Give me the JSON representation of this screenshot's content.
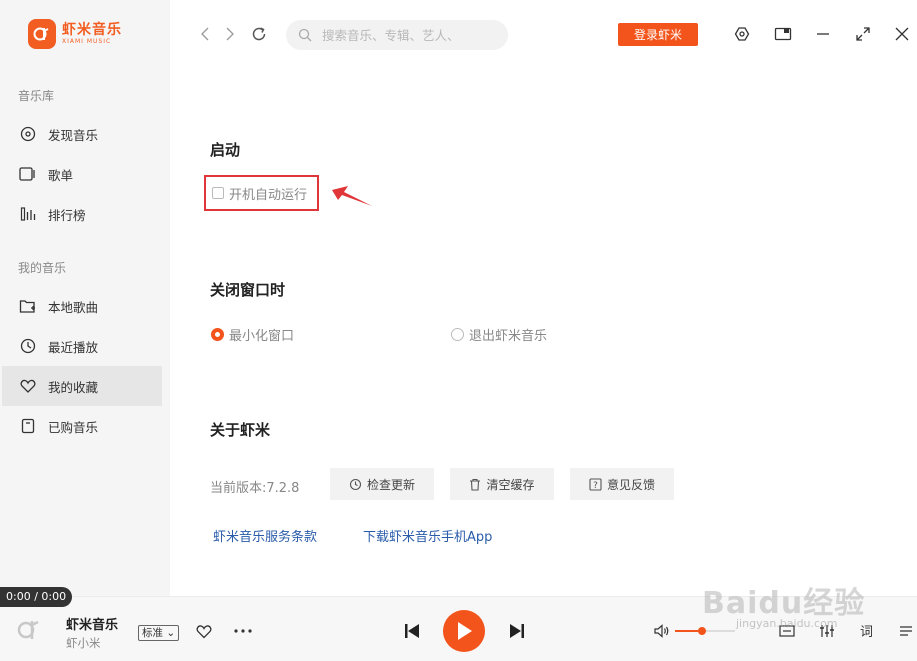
{
  "app": {
    "logo_cn": "虾米音乐",
    "logo_en": "XIAMI MUSIC",
    "brand_color": "#f2541b"
  },
  "header": {
    "search_placeholder": "搜索音乐、专辑、艺人、",
    "login_label": "登录虾米"
  },
  "sidebar": {
    "library_title": "音乐库",
    "library_items": [
      {
        "label": "发现音乐",
        "icon": "disc-icon"
      },
      {
        "label": "歌单",
        "icon": "playlist-icon"
      },
      {
        "label": "排行榜",
        "icon": "chart-bars-icon"
      }
    ],
    "mine_title": "我的音乐",
    "mine_items": [
      {
        "label": "本地歌曲",
        "icon": "folder-icon"
      },
      {
        "label": "最近播放",
        "icon": "clock-icon"
      },
      {
        "label": "我的收藏",
        "icon": "heart-icon"
      },
      {
        "label": "已购音乐",
        "icon": "purchase-icon"
      }
    ],
    "active_item": "我的收藏"
  },
  "settings": {
    "startup_title": "启动",
    "autostart_label": "开机自动运行",
    "autostart_checked": false,
    "close_title": "关闭窗口时",
    "close_options": [
      "最小化窗口",
      "退出虾米音乐"
    ],
    "close_selected": "最小化窗口",
    "about_title": "关于虾米",
    "version_text": "当前版本:7.2.8",
    "buttons": [
      "检查更新",
      "清空缓存",
      "意见反馈"
    ],
    "links": [
      "虾米音乐服务条款",
      "下载虾米音乐手机App"
    ]
  },
  "player": {
    "time": "0:00 / 0:00",
    "song_title": "虾米音乐",
    "artist": "虾小米",
    "quality": "标准",
    "lyric_label": "词",
    "volume": 0.45
  },
  "watermark": {
    "text": "Baidu经验",
    "sub": "jingyan.baidu.com"
  }
}
